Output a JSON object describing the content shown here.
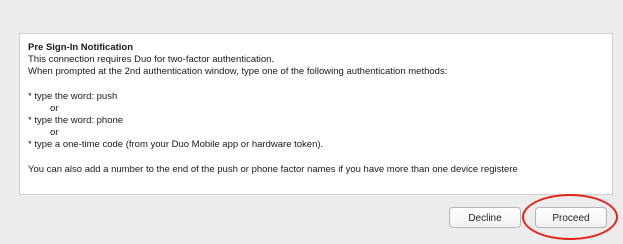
{
  "notification": {
    "title": "Pre Sign-In Notification",
    "line1": "This connection requires Duo for two-factor authentication.",
    "line2": "When prompted at the 2nd authentication window, type one of the following authentication methods:",
    "method1": "* type the word:  push",
    "or1": "or",
    "method2": "* type the word:  phone",
    "or2": "or",
    "method3": "* type a one-time code (from your Duo Mobile app or hardware token).",
    "footer": "You can also add a number to the end of the push or phone factor names if you have more than one device registere"
  },
  "buttons": {
    "decline_label": "Decline",
    "proceed_label": "Proceed"
  },
  "colors": {
    "annotation_ring": "#e2231a",
    "background": "#ececec",
    "panel": "#ffffff"
  }
}
